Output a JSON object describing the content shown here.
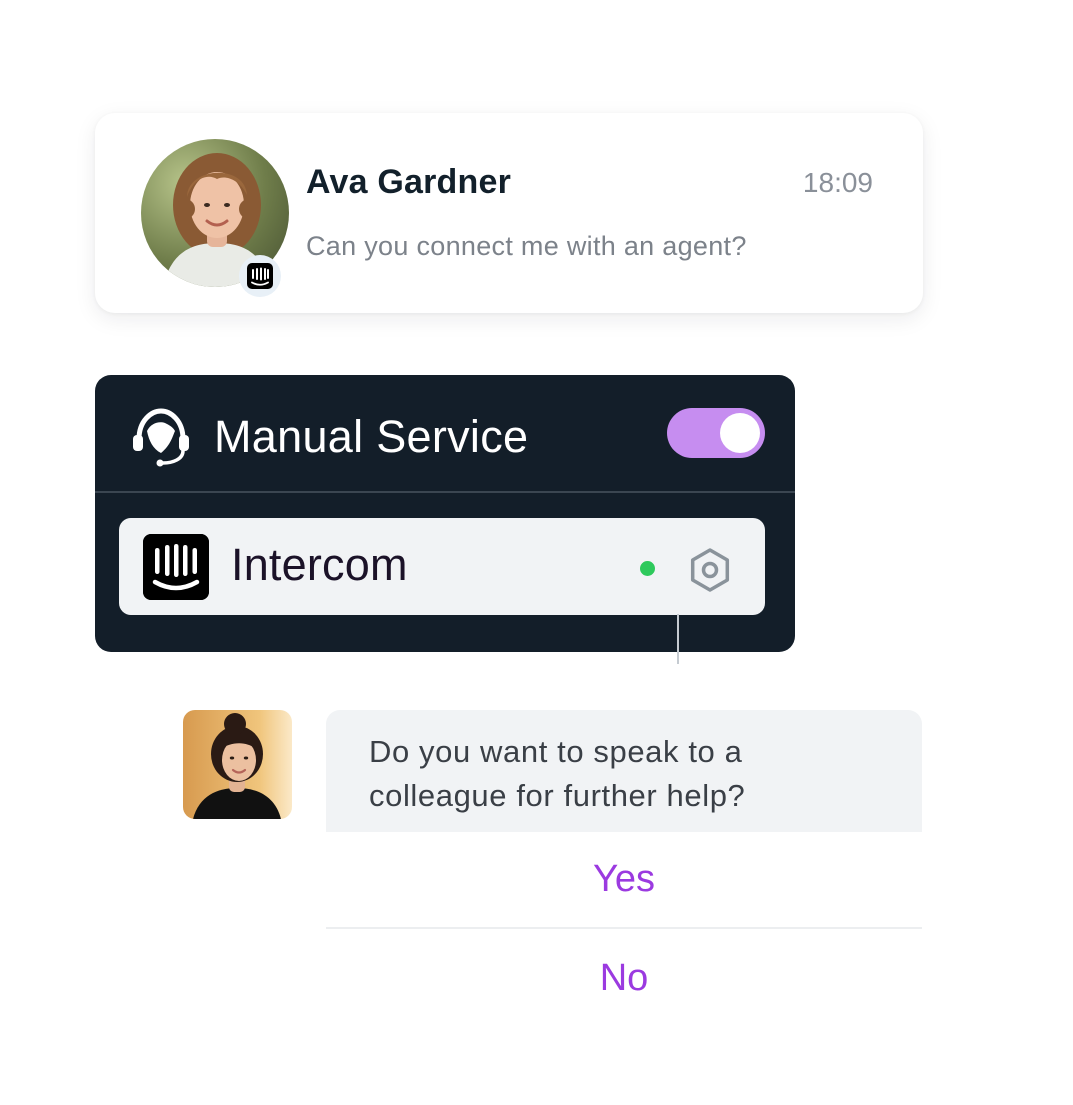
{
  "conversation": {
    "name": "Ava Gardner",
    "time": "18:09",
    "message": "Can you connect me with an agent?",
    "avatar_icon": "user-photo-avatar",
    "badge_icon": "intercom-icon"
  },
  "service": {
    "title": "Manual Service",
    "title_icon": "headset-icon",
    "toggle_on": true,
    "toggle_color": "#c68df0",
    "provider": {
      "name": "Intercom",
      "logo_icon": "intercom-icon",
      "status_color": "#2ec95c",
      "settings_icon": "hexagon-settings-icon"
    },
    "panel_color": "#131e29"
  },
  "prompt": {
    "avatar_icon": "agent-photo-avatar",
    "question": "Do you want to speak to a colleague for further help?",
    "options": [
      "Yes",
      "No"
    ],
    "accent_color": "#9b3ae0"
  }
}
